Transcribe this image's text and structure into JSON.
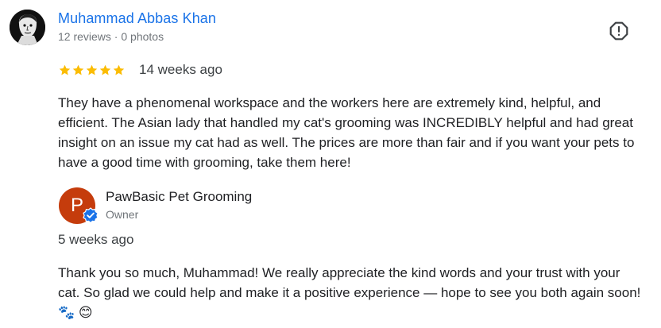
{
  "review": {
    "author": "Muhammad Abbas Khan",
    "meta": "12 reviews · 0 photos",
    "rating": 5,
    "rating_max": 5,
    "date": "14 weeks ago",
    "text": "They have a phenomenal workspace and the workers here are extremely kind, helpful, and efficient. The Asian lady that handled my cat's grooming was INCREDIBLY helpful and had great insight on an issue my cat had as well. The prices are more than fair and if you want your pets to have a good time with grooming, take them here!"
  },
  "reply": {
    "owner_initial": "P",
    "owner_name": "PawBasic Pet Grooming",
    "owner_role": "Owner",
    "date": "5 weeks ago",
    "text": "Thank you so much, Muhammad! We really appreciate the kind words and your trust with your cat. So glad we could help and make it a positive experience — hope to see you both again soon! 🐾 😊"
  },
  "colors": {
    "link_blue": "#1a73e8",
    "star_gold": "#fbbc04",
    "owner_avatar_bg": "#c53c0c",
    "verified_blue": "#1a73e8",
    "secondary_text": "#70757a"
  },
  "icons": {
    "report": "report-exclamation-icon",
    "verified": "verified-check-icon",
    "star": "star-icon"
  }
}
